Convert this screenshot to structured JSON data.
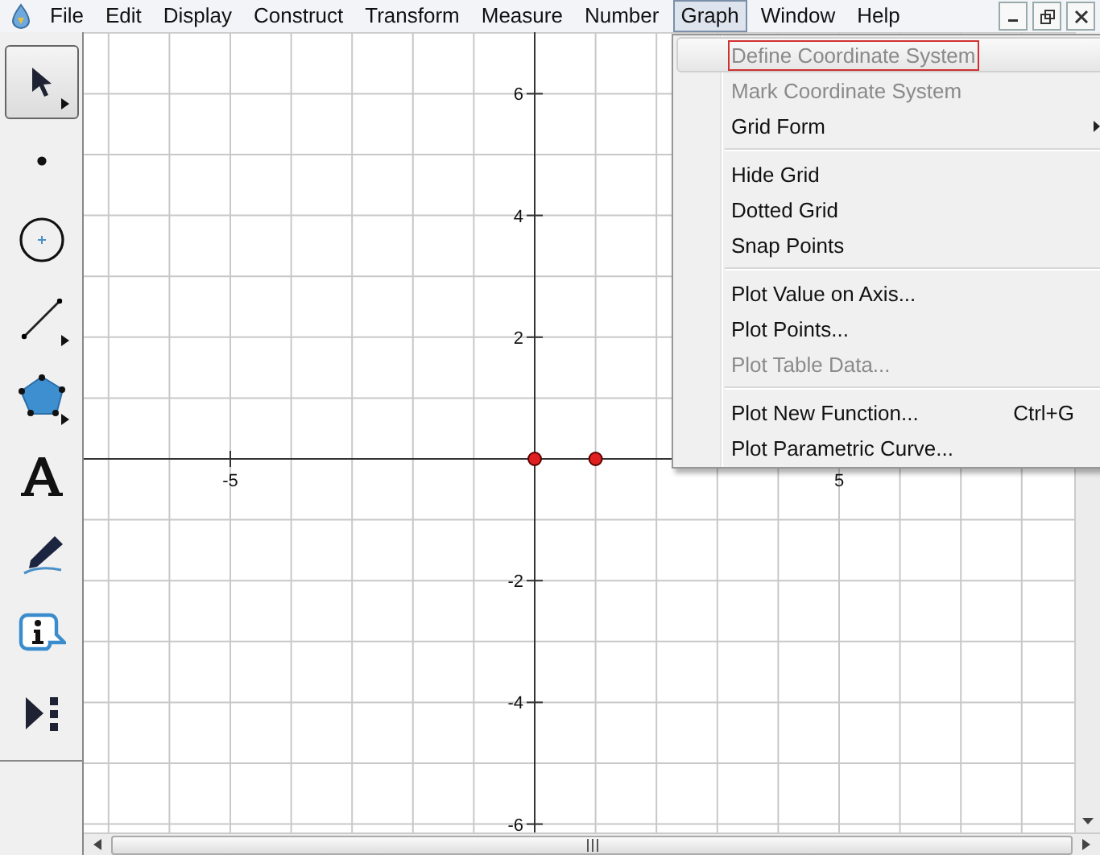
{
  "menu_bar": {
    "items": [
      {
        "label": "File",
        "selected": false
      },
      {
        "label": "Edit",
        "selected": false
      },
      {
        "label": "Display",
        "selected": false
      },
      {
        "label": "Construct",
        "selected": false
      },
      {
        "label": "Transform",
        "selected": false
      },
      {
        "label": "Measure",
        "selected": false
      },
      {
        "label": "Number",
        "selected": false
      },
      {
        "label": "Graph",
        "selected": true
      },
      {
        "label": "Window",
        "selected": false
      },
      {
        "label": "Help",
        "selected": false
      }
    ]
  },
  "toolbox": [
    {
      "kind": "arrow",
      "selected": true,
      "has_options": true
    },
    {
      "kind": "point",
      "selected": false,
      "has_options": false
    },
    {
      "kind": "compass",
      "selected": false,
      "has_options": false
    },
    {
      "kind": "line",
      "selected": false,
      "has_options": true
    },
    {
      "kind": "polygon",
      "selected": false,
      "has_options": true
    },
    {
      "kind": "text",
      "selected": false,
      "has_options": false
    },
    {
      "kind": "marker",
      "selected": false,
      "has_options": false
    },
    {
      "kind": "info",
      "selected": false,
      "has_options": false
    },
    {
      "kind": "custom",
      "selected": false,
      "has_options": false
    }
  ],
  "graph": {
    "x_labels": [
      "-5",
      "5"
    ],
    "y_labels": [
      "6",
      "4",
      "2",
      "-2",
      "-4",
      "-6"
    ]
  },
  "graph_menu": {
    "groups": [
      [
        {
          "label": "Define Coordinate System",
          "disabled": true,
          "selected": true,
          "submenu": false
        },
        {
          "label": "Mark Coordinate System",
          "disabled": true,
          "selected": false,
          "submenu": false
        },
        {
          "label": "Grid Form",
          "disabled": false,
          "selected": false,
          "submenu": true
        }
      ],
      [
        {
          "label": "Hide Grid",
          "disabled": false,
          "selected": false,
          "submenu": false
        },
        {
          "label": "Dotted Grid",
          "disabled": false,
          "selected": false,
          "submenu": false
        },
        {
          "label": "Snap Points",
          "disabled": false,
          "selected": false,
          "submenu": false
        }
      ],
      [
        {
          "label": "Plot Value on Axis...",
          "disabled": false,
          "selected": false,
          "submenu": false
        },
        {
          "label": "Plot Points...",
          "disabled": false,
          "selected": false,
          "submenu": false
        },
        {
          "label": "Plot Table Data...",
          "disabled": true,
          "selected": false,
          "submenu": false
        }
      ],
      [
        {
          "label": "Plot New Function...",
          "shortcut": "Ctrl+G",
          "disabled": false,
          "selected": false,
          "submenu": false
        },
        {
          "label": "Plot Parametric Curve...",
          "disabled": false,
          "selected": false,
          "submenu": false
        }
      ]
    ]
  }
}
